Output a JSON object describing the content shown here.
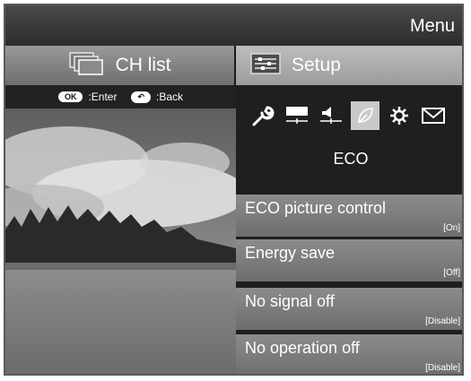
{
  "header": {
    "title": "Menu"
  },
  "tabs": [
    {
      "label": "CH list",
      "icon": "channel-list-icon"
    },
    {
      "label": "Setup",
      "icon": "setup-icon"
    }
  ],
  "hints": {
    "ok_badge": "OK",
    "ok_label": ":Enter",
    "back_label": ":Back"
  },
  "setup": {
    "category_icons": [
      "wrench-icon",
      "picture-icon",
      "sound-icon",
      "eco-leaf-icon",
      "gear-icon",
      "envelope-icon"
    ],
    "selected_category": "ECO",
    "items": [
      {
        "label": "ECO picture control",
        "value": "[On]"
      },
      {
        "label": "Energy save",
        "value": "[Off]"
      },
      {
        "label": "No signal off",
        "value": "[Disable]"
      },
      {
        "label": "No operation off",
        "value": "[Disable]"
      }
    ]
  }
}
